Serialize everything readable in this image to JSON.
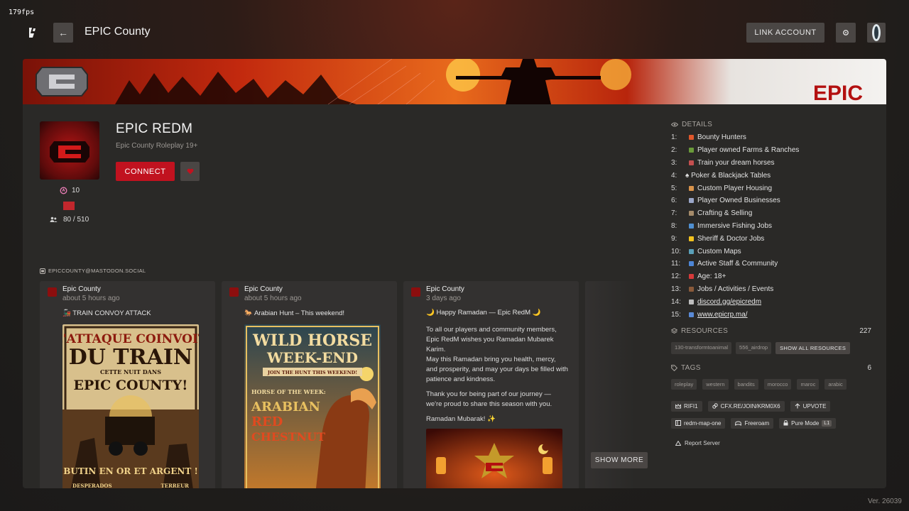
{
  "fps": "179fps",
  "header": {
    "title": "EPIC County",
    "link_account": "LINK ACCOUNT"
  },
  "server": {
    "name": "EPIC REDM",
    "subtitle": "Epic County Roleplay 19+",
    "connect_label": "CONNECT",
    "boosts": "10",
    "players": "80 / 510",
    "banner_text": "EPIC"
  },
  "mastodon": {
    "label": "EPICCOUNTY@MASTODON.SOCIAL",
    "show_more": "SHOW MORE",
    "posts": [
      {
        "author": "Epic County",
        "time": "about 5 hours ago",
        "headline": "🚂 TRAIN CONVOY ATTACK",
        "poster": {
          "title1": "L'ATTAQUE COINVOIT",
          "title2": "DU TRAIN",
          "sub": "CETTE NUIT DANS",
          "title3": "EPIC COUNTY!",
          "footer": "BUTIN EN OR ET ARGENT !",
          "left": "DESPERADOS",
          "right": "TERREUR"
        }
      },
      {
        "author": "Epic County",
        "time": "about 5 hours ago",
        "headline": "🐎 Arabian Hunt – This weekend!",
        "poster": {
          "title1": "WILD HORSE",
          "title2": "WEEK-END",
          "ribbon": "JOIN THE HUNT THIS WEEKEND!",
          "week": "HORSE OF THE WEEK:",
          "breed1": "ARABIAN",
          "breed2": "RED",
          "breed3": "CHESTNUT"
        }
      },
      {
        "author": "Epic County",
        "time": "3 days ago",
        "headline": "🌙 Happy Ramadan — Epic RedM 🌙",
        "paragraphs": [
          "To all our players and community members, Epic RedM wishes you Ramadan Mubarek Karim.\nMay this Ramadan bring you health, mercy, and prosperity, and may your days be filled with patience and kindness.",
          "Thank you for being part of our journey — we're proud to share this season with you.",
          "Ramadan Mubarak! ✨"
        ]
      }
    ]
  },
  "details": {
    "title": "DETAILS",
    "items": [
      {
        "n": "1:",
        "text": "Bounty Hunters",
        "color": "#e0572b"
      },
      {
        "n": "2:",
        "text": "Player owned Farms & Ranches",
        "color": "#6a9a3a"
      },
      {
        "n": "3:",
        "text": "Train your dream horses",
        "color": "#c44f4f"
      },
      {
        "n": "4:",
        "text": "♠ Poker & Blackjack Tables",
        "color": ""
      },
      {
        "n": "5:",
        "text": "Custom Player Housing",
        "color": "#d9934b"
      },
      {
        "n": "6:",
        "text": "Player Owned Businesses",
        "color": "#9aa6c8"
      },
      {
        "n": "7:",
        "text": "Crafting & Selling",
        "color": "#a58b6a"
      },
      {
        "n": "8:",
        "text": "Immersive Fishing Jobs",
        "color": "#4f8fd0"
      },
      {
        "n": "9:",
        "text": "Sheriff & Doctor Jobs",
        "color": "#f2c21e"
      },
      {
        "n": "10:",
        "text": "Custom Maps",
        "color": "#5aa0b8"
      },
      {
        "n": "11:",
        "text": "Active Staff & Community",
        "color": "#4d86d6"
      },
      {
        "n": "12:",
        "text": "Age: 18+",
        "color": "#d63a3a"
      },
      {
        "n": "13:",
        "text": "Jobs / Activities / Events",
        "color": "#8a5a3a"
      },
      {
        "n": "14:",
        "text": "discord.gg/epicredm",
        "color": "#bdbdbd",
        "link": true
      },
      {
        "n": "15:",
        "text": "www.epicrp.ma/",
        "color": "#5a8ad6",
        "link": true
      }
    ]
  },
  "resources": {
    "title": "RESOURCES",
    "count": "227",
    "items": [
      "130-transformtoanimal",
      "556_airdrop"
    ],
    "show_all": "SHOW ALL RESOURCES"
  },
  "tags": {
    "title": "TAGS",
    "count": "6",
    "items": [
      "roleplay",
      "western",
      "bandits",
      "morocco",
      "maroc",
      "arabic"
    ]
  },
  "meta": {
    "owner": "RIFI1",
    "join": "CFX.RE/JOIN/KRM0X6",
    "upvote": "UPVOTE",
    "map": "redm-map-one",
    "mode": "Freeroam",
    "pure": "Pure Mode",
    "pure_level": "L1",
    "report": "Report Server"
  },
  "version": "Ver. 26039",
  "colors": {
    "accent": "#c1121f",
    "card": "#2a2927",
    "button": "#4a4644"
  }
}
